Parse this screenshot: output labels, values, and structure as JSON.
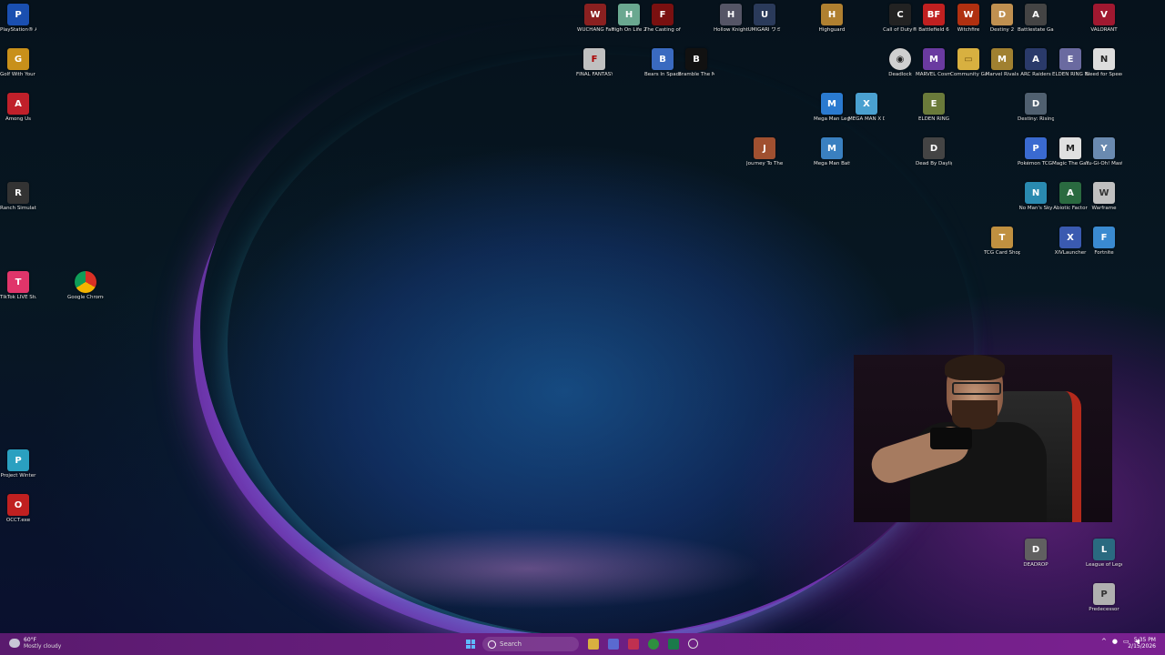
{
  "desktop_icons": [
    {
      "id": "ps",
      "label": "PlayStation® Accessories",
      "color": "#1a4fb0",
      "glyph": "P"
    },
    {
      "id": "golf",
      "label": "Golf With Your Friends",
      "color": "#c8901a",
      "glyph": "G"
    },
    {
      "id": "among",
      "label": "Among Us",
      "color": "#c0202a",
      "glyph": "A"
    },
    {
      "id": "ranch",
      "label": "Ranch Simulator",
      "color": "#333333",
      "glyph": "R"
    },
    {
      "id": "tiktok",
      "label": "TikTok LIVE Studio",
      "color": "#e0356a",
      "glyph": "T"
    },
    {
      "id": "chrome",
      "label": "Google Chrome",
      "color": "#2f8f3f",
      "glyph": "C"
    },
    {
      "id": "pw",
      "label": "Project Winter",
      "color": "#2aa0c0",
      "glyph": "P"
    },
    {
      "id": "occt",
      "label": "OCCT.exe",
      "color": "#c02020",
      "glyph": "O"
    },
    {
      "id": "wuchang",
      "label": "WUCHANG Fallen Fea...",
      "color": "#8a2020",
      "glyph": "W"
    },
    {
      "id": "hol2",
      "label": "High On Life 2",
      "color": "#6aa890",
      "glyph": "H"
    },
    {
      "id": "frank",
      "label": "The Casting of Frank S...",
      "color": "#7a1010",
      "glyph": "F"
    },
    {
      "id": "hollow",
      "label": "Hollow Knight",
      "color": "#555566",
      "glyph": "H"
    },
    {
      "id": "umigari",
      "label": "UMIGARI ウミ",
      "color": "#2a3a5a",
      "glyph": "U"
    },
    {
      "id": "highguard",
      "label": "Highguard",
      "color": "#b08030",
      "glyph": "H"
    },
    {
      "id": "cod",
      "label": "Call of Duty®",
      "color": "#222222",
      "glyph": "C"
    },
    {
      "id": "bf6",
      "label": "Battlefield 6",
      "color": "#c02020",
      "glyph": "BF"
    },
    {
      "id": "witchfire",
      "label": "Witchfire",
      "color": "#b03010",
      "glyph": "W"
    },
    {
      "id": "destiny2",
      "label": "Destiny 2",
      "color": "#c09050",
      "glyph": "D"
    },
    {
      "id": "battlestate",
      "label": "Battlestate Games L...",
      "color": "#444444",
      "glyph": "A"
    },
    {
      "id": "valorant",
      "label": "VALORANT",
      "color": "#a01830",
      "glyph": "V"
    },
    {
      "id": "ff",
      "label": "FINAL FANTASY",
      "color": "#c0c0c0",
      "glyph": "F"
    },
    {
      "id": "bears",
      "label": "Bears In Space",
      "color": "#3a6ac0",
      "glyph": "B"
    },
    {
      "id": "bramble",
      "label": "Bramble The Mountain ...",
      "color": "#111111",
      "glyph": "B"
    },
    {
      "id": "deadlock",
      "label": "Deadlock",
      "color": "#d0d0d0",
      "glyph": "◉"
    },
    {
      "id": "marvelcos",
      "label": "MARVEL Cosmi...",
      "color": "#6a3aa0",
      "glyph": "M"
    },
    {
      "id": "community",
      "label": "Community Games",
      "color": "#d8b040",
      "glyph": "▭"
    },
    {
      "id": "marvelrivals",
      "label": "Marvel Rivals",
      "color": "#a08030",
      "glyph": "M"
    },
    {
      "id": "arc",
      "label": "ARC Raiders",
      "color": "#2a3a6a",
      "glyph": "A"
    },
    {
      "id": "eldennr",
      "label": "ELDEN RING NIGHTREIGN",
      "color": "#6a6aa0",
      "glyph": "E"
    },
    {
      "id": "nfs",
      "label": "Need for Speed...",
      "color": "#dddddd",
      "glyph": "N"
    },
    {
      "id": "megaman",
      "label": "Mega Man Legacy C...",
      "color": "#2a7ad0",
      "glyph": "M"
    },
    {
      "id": "megamanx",
      "label": "MEGA MAN X DiVE Of...",
      "color": "#4aa0d0",
      "glyph": "X"
    },
    {
      "id": "elden",
      "label": "ELDEN RING",
      "color": "#6a7a3a",
      "glyph": "E"
    },
    {
      "id": "destinyrising",
      "label": "Destiny: Rising-And...",
      "color": "#506070",
      "glyph": "D"
    },
    {
      "id": "journey",
      "label": "Journey To The Sava...",
      "color": "#a05030",
      "glyph": "J"
    },
    {
      "id": "mmbn",
      "label": "Mega Man Battle Ne...",
      "color": "#3a80c0",
      "glyph": "M"
    },
    {
      "id": "dbd",
      "label": "Dead By Daylight",
      "color": "#444444",
      "glyph": "D"
    },
    {
      "id": "pokemon",
      "label": "Pokémon TCG Live",
      "color": "#3a6ad0",
      "glyph": "P"
    },
    {
      "id": "mtg",
      "label": "Magic The Gatherin...",
      "color": "#e0e0e0",
      "glyph": "M"
    },
    {
      "id": "yugioh",
      "label": "Yu-Gi-Oh! Master Duel",
      "color": "#6a8ab0",
      "glyph": "Y"
    },
    {
      "id": "nms",
      "label": "No Man's Sky",
      "color": "#2a8ab0",
      "glyph": "N"
    },
    {
      "id": "abiotic",
      "label": "Abiotic Factor",
      "color": "#2a6a40",
      "glyph": "A"
    },
    {
      "id": "warframe",
      "label": "Warframe",
      "color": "#c0c0c0",
      "glyph": "W"
    },
    {
      "id": "tcgshop",
      "label": "TCG Card Shop Si...",
      "color": "#c09040",
      "glyph": "T"
    },
    {
      "id": "xiv",
      "label": "XIVLauncher",
      "color": "#3a5ab0",
      "glyph": "X"
    },
    {
      "id": "fortnite",
      "label": "Fortnite",
      "color": "#3a8ad0",
      "glyph": "F"
    },
    {
      "id": "deadrop",
      "label": "DEADROP",
      "color": "#606060",
      "glyph": "D"
    },
    {
      "id": "lol",
      "label": "League of Legends",
      "color": "#2a6a80",
      "glyph": "L"
    },
    {
      "id": "predecessor",
      "label": "Predecessor",
      "color": "#b0b0b0",
      "glyph": "P"
    }
  ],
  "taskbar": {
    "weather_temp": "60°F",
    "weather_desc": "Mostly cloudy",
    "search_placeholder": "Search",
    "time": "5:35 PM",
    "date": "2/15/2026"
  },
  "colors": {
    "taskbar": "#6b1f82",
    "start_accent": "#5fb8ff"
  }
}
